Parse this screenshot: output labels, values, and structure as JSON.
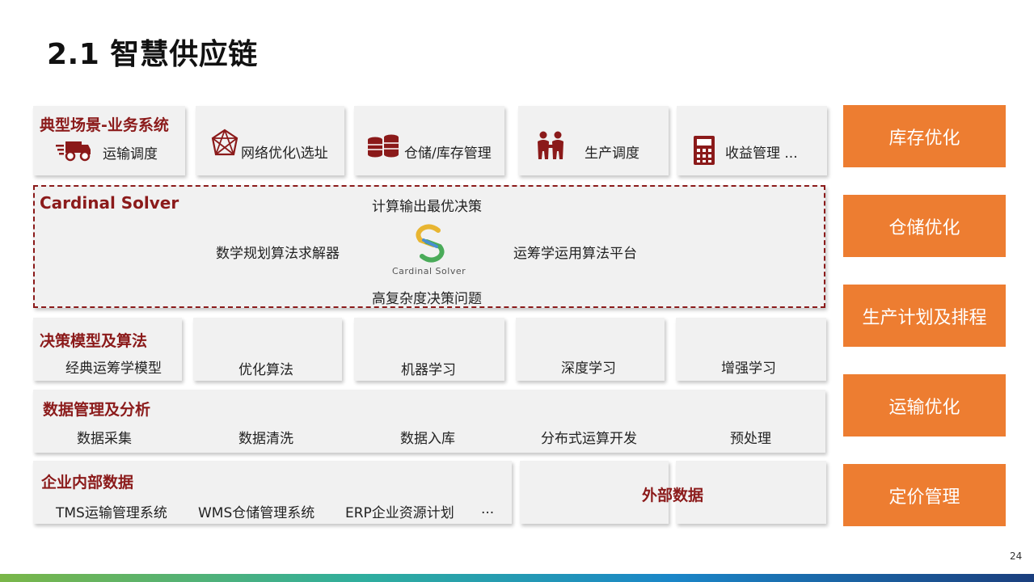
{
  "title": "2.1 智慧供应链",
  "page_number": "24",
  "scenarios": {
    "title": "典型场景-业务系统",
    "items": [
      "运输调度",
      "网络优化\\选址",
      "仓储/库存管理",
      "生产调度",
      "收益管理  ..."
    ]
  },
  "solver": {
    "title": "Cardinal Solver",
    "top": "计算输出最优决策",
    "left": "数学规划算法求解器",
    "right": "运筹学运用算法平台",
    "bottom": "高复杂度决策问题",
    "logo_text": "Cardinal Solver"
  },
  "models": {
    "title": "决策模型及算法",
    "items": [
      "经典运筹学模型",
      "优化算法",
      "机器学习",
      "深度学习",
      "增强学习"
    ]
  },
  "data_mgmt": {
    "title": "数据管理及分析",
    "items": [
      "数据采集",
      "数据清洗",
      "数据入库",
      "分布式运算开发",
      "预处理"
    ]
  },
  "internal": {
    "title": "企业内部数据",
    "items": [
      "TMS运输管理系统",
      "WMS仓储管理系统",
      "ERP企业资源计划",
      "..."
    ]
  },
  "external": {
    "label": "外部数据"
  },
  "side_buttons": [
    "库存优化",
    "仓储优化",
    "生产计划及排程",
    "运输优化",
    "定价管理"
  ],
  "colors": {
    "accent_red": "#8b1a1a",
    "orange": "#ed7d31",
    "panel": "#f1f1f1"
  },
  "icons": [
    "truck-icon",
    "network-icon",
    "database-icon",
    "workers-icon",
    "calculator-icon",
    "cardinal-solver-logo"
  ]
}
